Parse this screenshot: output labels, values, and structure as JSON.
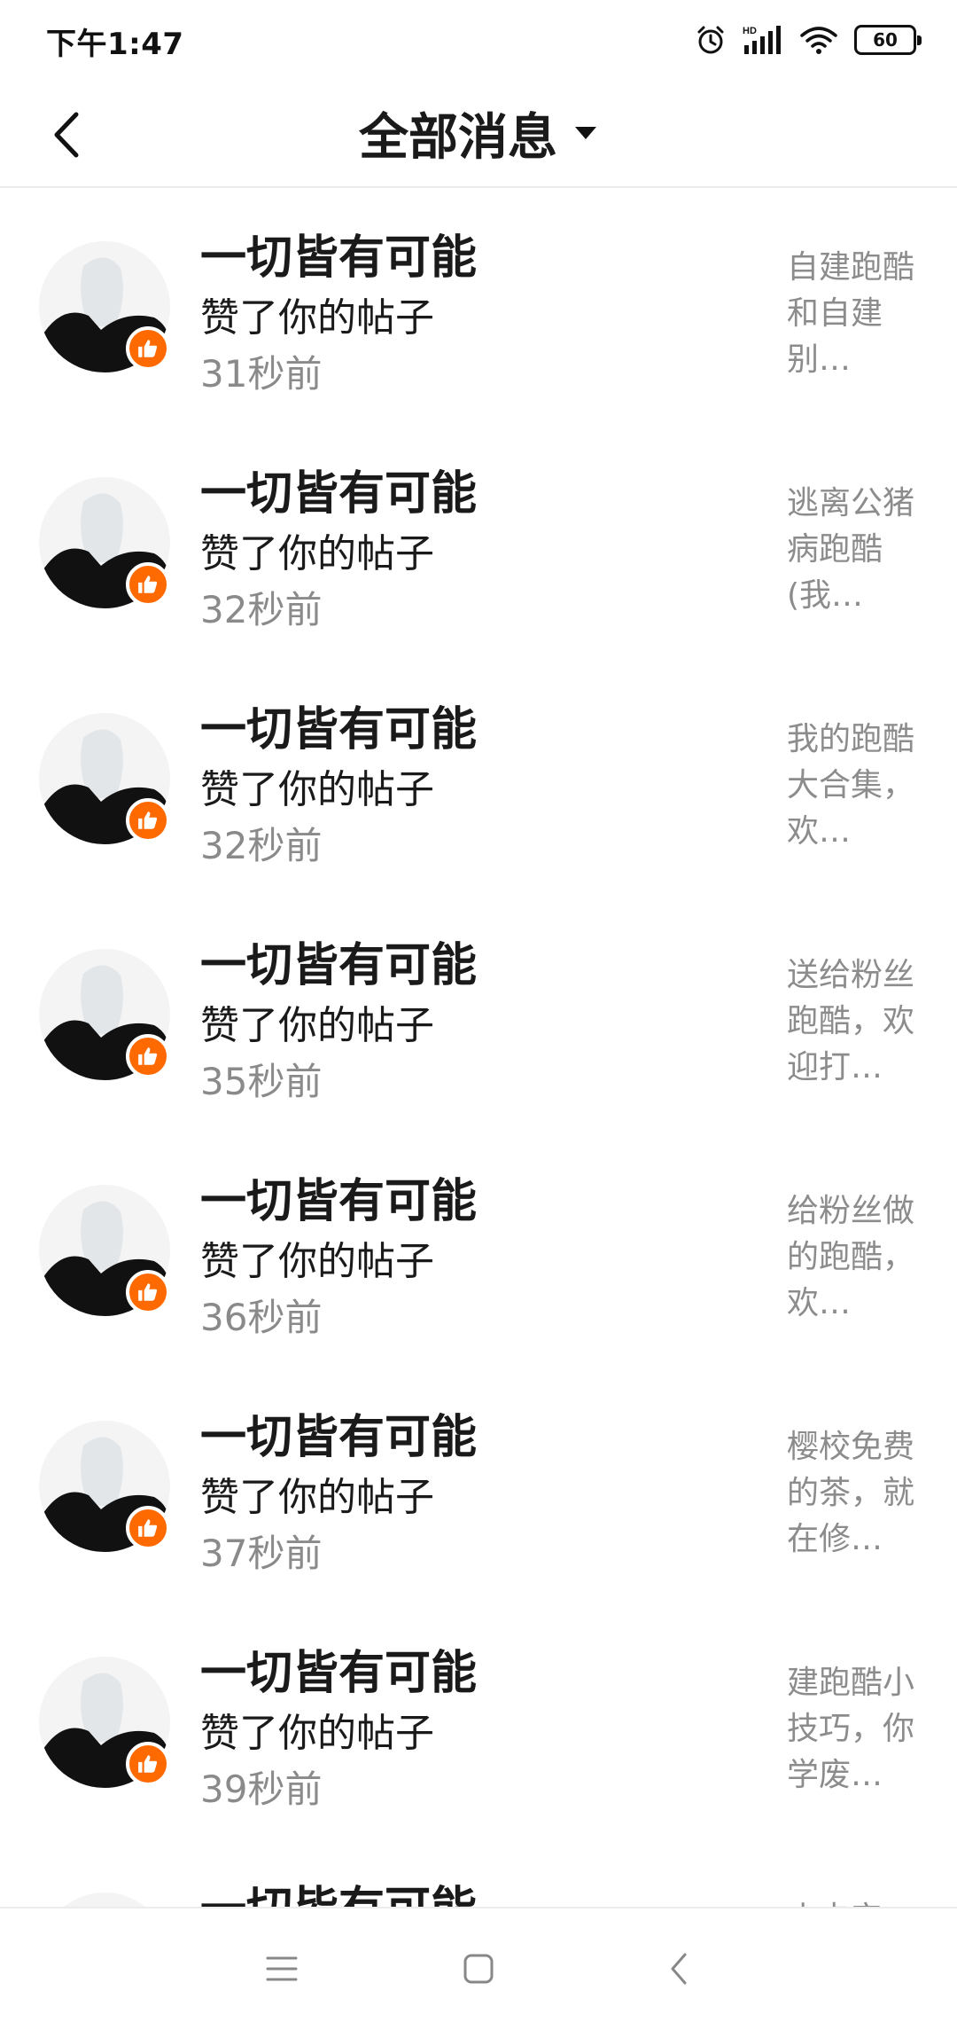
{
  "status_bar": {
    "time": "下午1:47",
    "battery": "60",
    "icons": [
      "alarm-icon",
      "signal-icon",
      "wifi-icon",
      "battery-icon"
    ]
  },
  "header": {
    "title": "全部消息",
    "back_icon": "chevron-left-icon",
    "dropdown_icon": "caret-down-icon"
  },
  "messages": [
    {
      "name": "一切皆有可能",
      "action": "赞了你的帖子",
      "time": "31秒前",
      "preview": "自建跑酷和自建别…"
    },
    {
      "name": "一切皆有可能",
      "action": "赞了你的帖子",
      "time": "32秒前",
      "preview": "逃离公猪病跑酷(我…"
    },
    {
      "name": "一切皆有可能",
      "action": "赞了你的帖子",
      "time": "32秒前",
      "preview": "我的跑酷大合集，欢…"
    },
    {
      "name": "一切皆有可能",
      "action": "赞了你的帖子",
      "time": "35秒前",
      "preview": "送给粉丝跑酷，欢迎打…"
    },
    {
      "name": "一切皆有可能",
      "action": "赞了你的帖子",
      "time": "36秒前",
      "preview": "给粉丝做的跑酷，欢…"
    },
    {
      "name": "一切皆有可能",
      "action": "赞了你的帖子",
      "time": "37秒前",
      "preview": "樱校免费的茶，就在修…"
    },
    {
      "name": "一切皆有可能",
      "action": "赞了你的帖子",
      "time": "39秒前",
      "preview": "建跑酷小技巧，你学废…"
    },
    {
      "name": "一切皆有可能",
      "action": "",
      "time": "",
      "preview": "小卡安"
    }
  ],
  "system_nav": {
    "icons": [
      "menu-icon",
      "home-square-icon",
      "back-triangle-icon"
    ]
  },
  "colors": {
    "accent": "#ff6a00",
    "text_primary": "#1a1a1a",
    "text_secondary": "#8a8a8a"
  }
}
